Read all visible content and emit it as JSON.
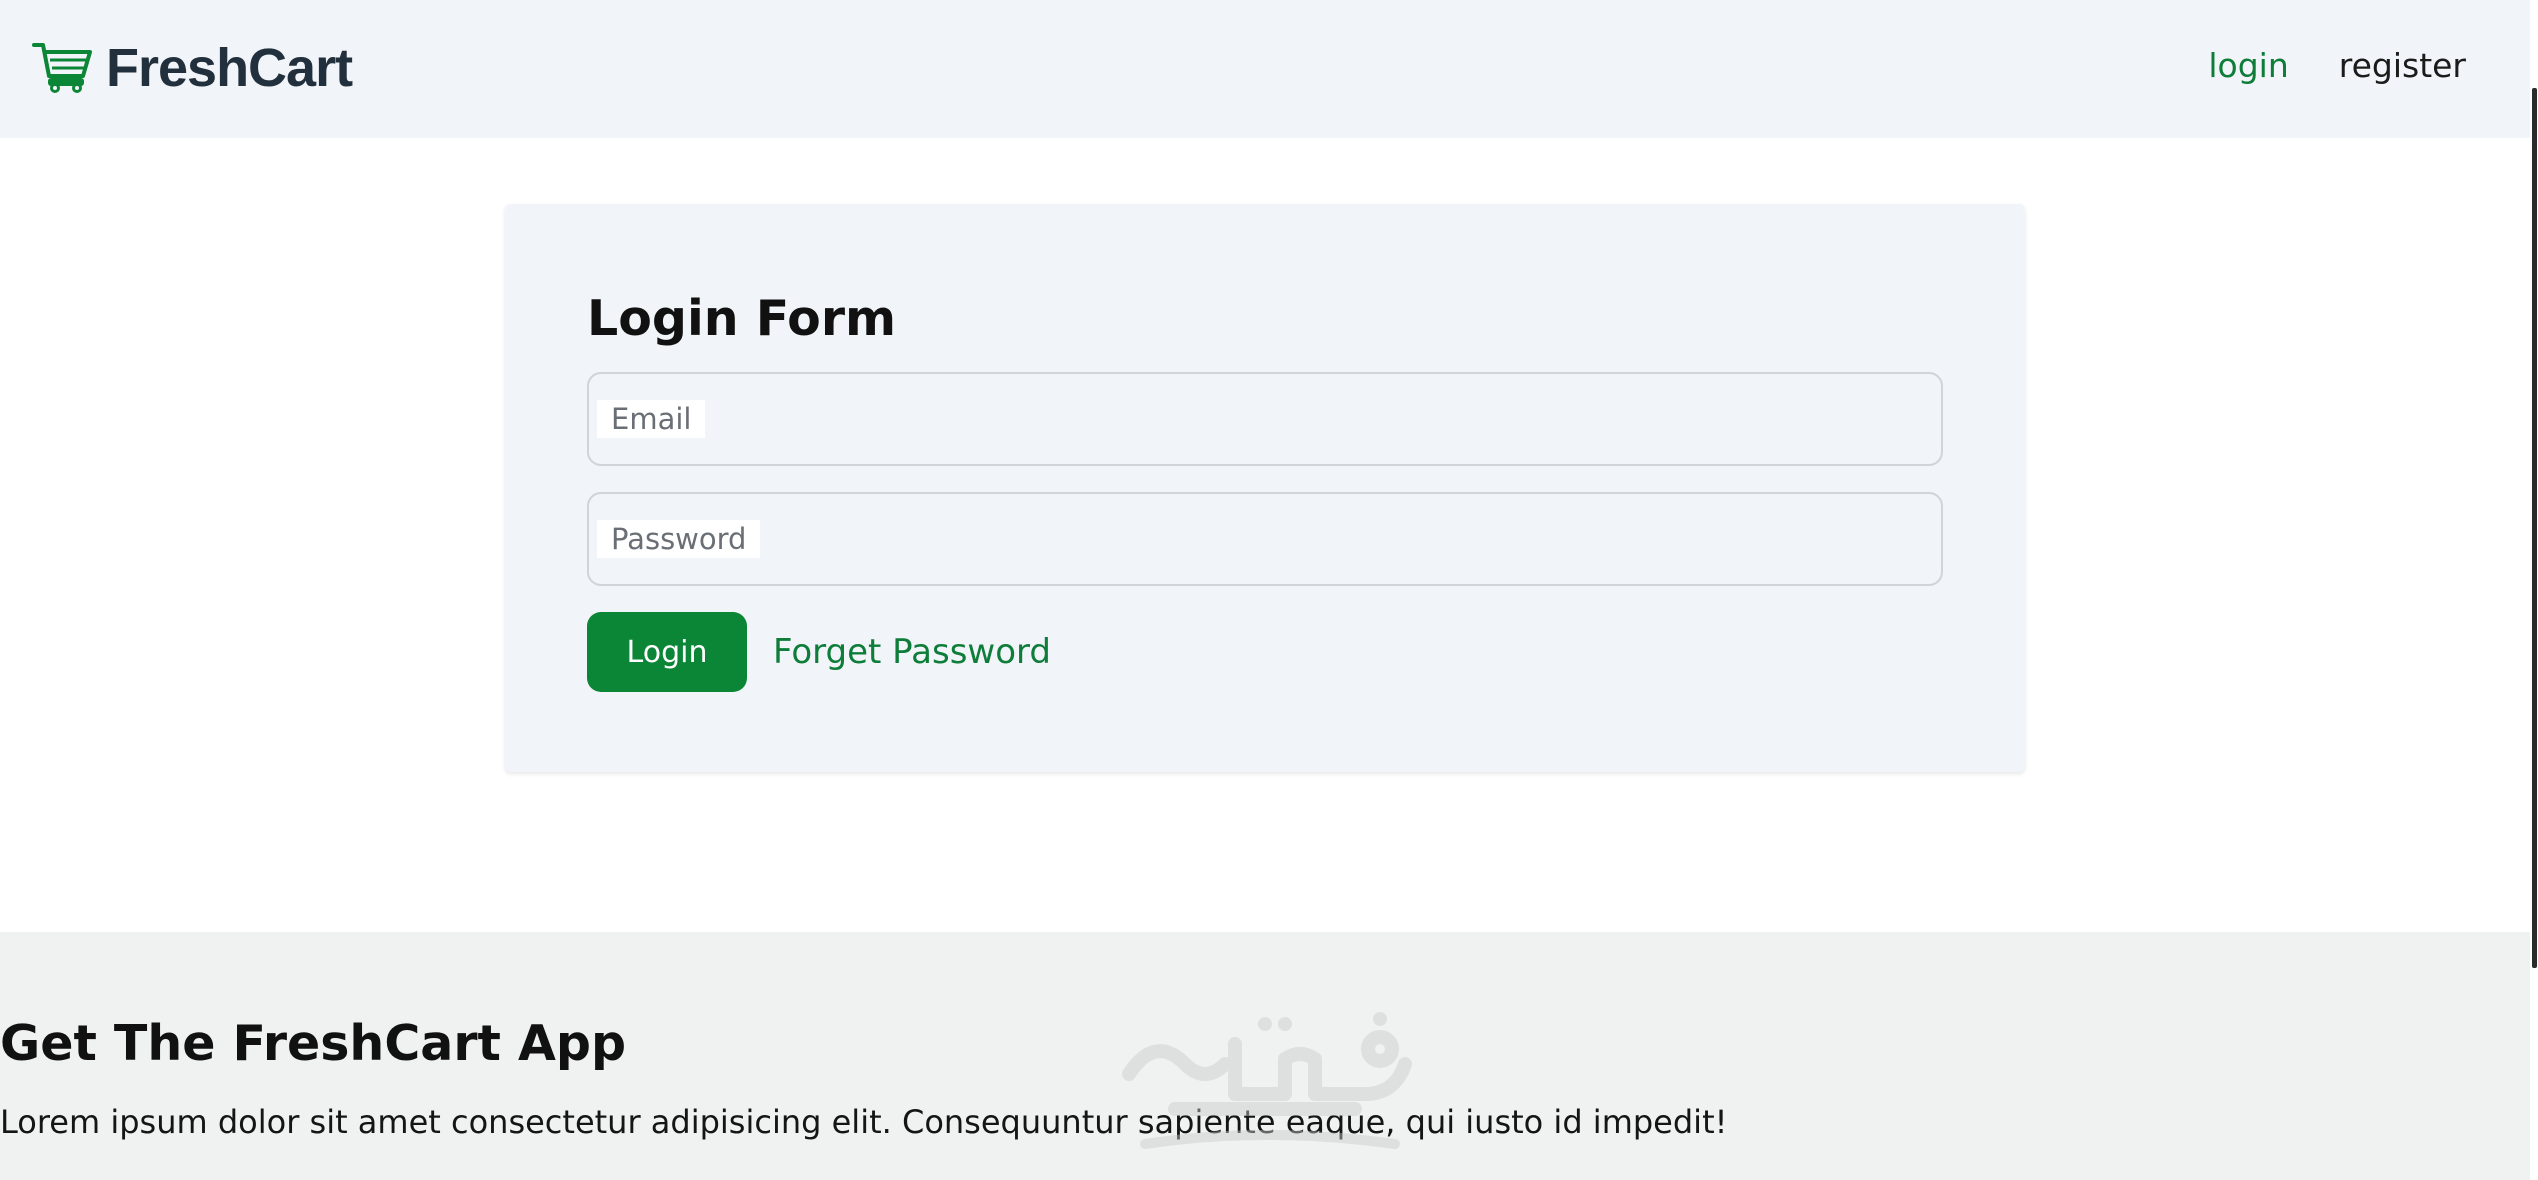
{
  "navbar": {
    "brand": "FreshCart",
    "links": [
      {
        "label": "login",
        "active": true
      },
      {
        "label": "register",
        "active": false
      }
    ]
  },
  "login_form": {
    "title": "Login Form",
    "email_label": "Email",
    "password_label": "Password",
    "submit_label": "Login",
    "forget_label": "Forget Password"
  },
  "footer": {
    "title": "Get The FreshCart App",
    "text": "Lorem ipsum dolor sit amet consectetur adipisicing elit. Consequuntur sapiente eaque, qui iusto id impedit!"
  },
  "colors": {
    "brand_green": "#0b8536",
    "link_green": "#0d7d39",
    "nav_bg": "#f1f4f8",
    "footer_bg": "#f0f2f2"
  },
  "icons": {
    "brand": "cart-icon"
  }
}
